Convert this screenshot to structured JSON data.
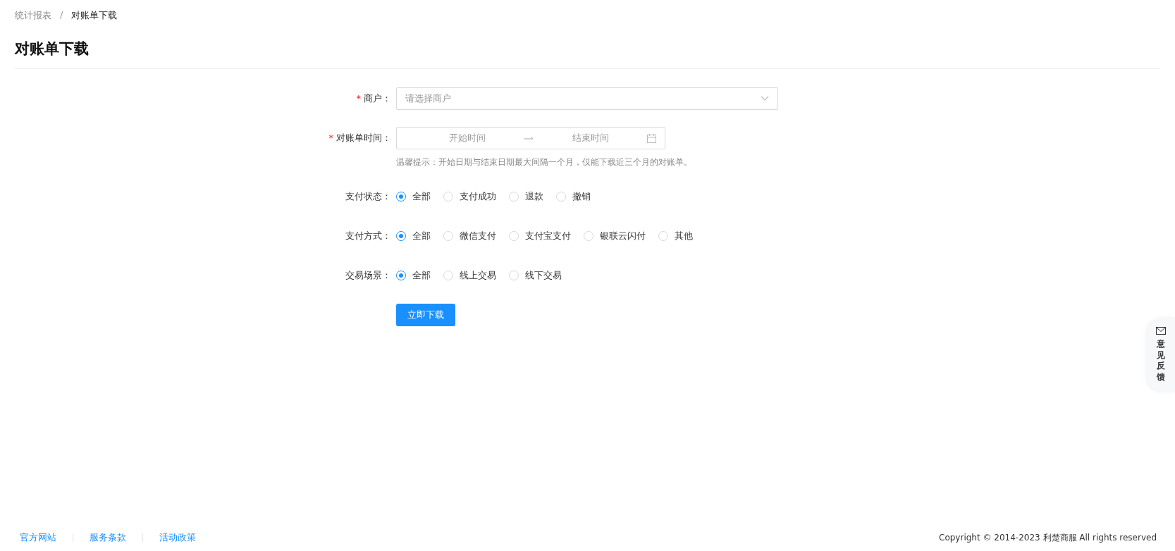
{
  "breadcrumb": [
    {
      "label": "统计报表",
      "current": false
    },
    {
      "label": "对账单下载",
      "current": true
    }
  ],
  "breadcrumb_separator": "/",
  "page_title": "对账单下载",
  "form": {
    "required_mark": "*",
    "merchant": {
      "label": "商户：",
      "required": true,
      "placeholder": "请选择商户"
    },
    "period": {
      "label": "对账单时间：",
      "required": true,
      "start_placeholder": "开始时间",
      "end_placeholder": "结束时间",
      "hint": "温馨提示：开始日期与结束日期最大间隔一个月，仅能下载近三个月的对账单。"
    },
    "radio_groups": [
      {
        "label": "支付状态：",
        "options": [
          {
            "label": "全部",
            "selected": true
          },
          {
            "label": "支付成功",
            "selected": false
          },
          {
            "label": "退款",
            "selected": false
          },
          {
            "label": "撤销",
            "selected": false
          }
        ]
      },
      {
        "label": "支付方式：",
        "options": [
          {
            "label": "全部",
            "selected": true
          },
          {
            "label": "微信支付",
            "selected": false
          },
          {
            "label": "支付宝支付",
            "selected": false
          },
          {
            "label": "银联云闪付",
            "selected": false
          },
          {
            "label": "其他",
            "selected": false
          }
        ]
      },
      {
        "label": "交易场景：",
        "options": [
          {
            "label": "全部",
            "selected": true
          },
          {
            "label": "线上交易",
            "selected": false
          },
          {
            "label": "线下交易",
            "selected": false
          }
        ]
      }
    ],
    "submit": "立即下载"
  },
  "feedback_tab": "意见反馈",
  "footer": {
    "links": [
      "官方网站",
      "服务条款",
      "活动政策"
    ],
    "copyright": "Copyright © 2014-2023 利楚商服 All rights reserved"
  }
}
